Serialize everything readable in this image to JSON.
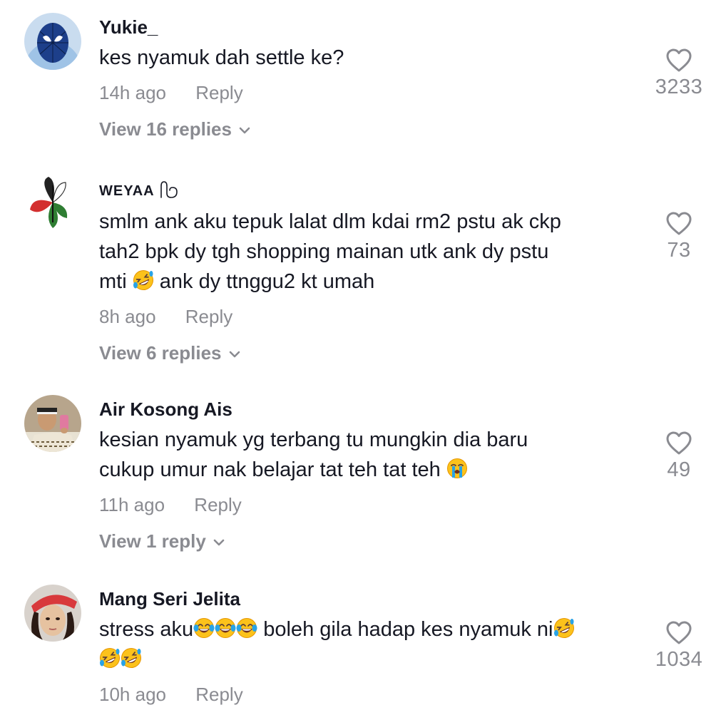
{
  "comments": [
    {
      "username": "Yukie_",
      "text": "kes nyamuk dah settle ke?",
      "time": "14h ago",
      "reply_label": "Reply",
      "likes": "3233",
      "view_replies": "View 16 replies"
    },
    {
      "username": "WEYAA",
      "text_1": "smlm ank aku tepuk lalat dlm kdai rm2 pstu ak ckp",
      "text_2": "tah2 bpk dy tgh shopping mainan utk ank dy pstu",
      "text_3a": "mti",
      "text_3b": "ank dy ttnggu2 kt umah",
      "time": "8h ago",
      "reply_label": "Reply",
      "likes": "73",
      "view_replies": "View 6 replies"
    },
    {
      "username": "Air Kosong Ais",
      "text_1": "kesian nyamuk yg terbang tu mungkin dia baru",
      "text_2": "cukup umur nak belajar tat teh tat teh",
      "time": "11h ago",
      "reply_label": "Reply",
      "likes": "49",
      "view_replies": "View 1 reply"
    },
    {
      "username": "Mang Seri Jelita",
      "text_a": "stress aku",
      "text_b": "boleh gila hadap kes nyamuk ni",
      "time": "10h ago",
      "reply_label": "Reply",
      "likes": "1034"
    }
  ],
  "icons": {
    "like": "heart-outline-icon",
    "expand": "chevron-down-icon",
    "emoji_rofl": "rolling-on-floor-laughing-emoji",
    "emoji_sob": "loudly-crying-emoji",
    "emoji_joy": "tears-of-joy-emoji"
  },
  "colors": {
    "text": "#161823",
    "secondary": "#8a8b91",
    "background": "#ffffff"
  }
}
